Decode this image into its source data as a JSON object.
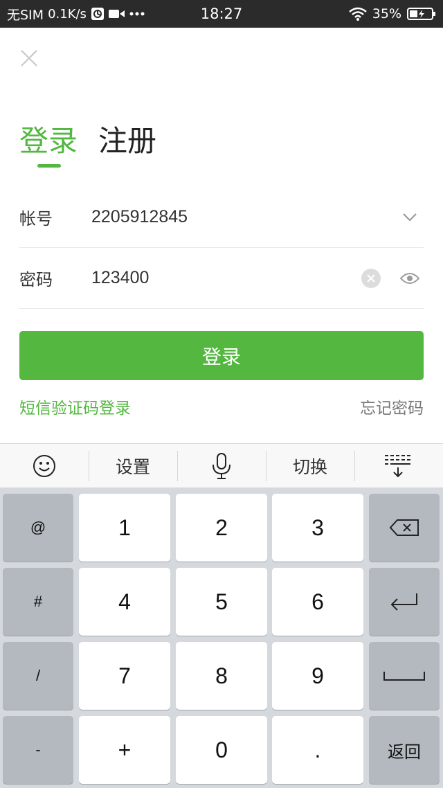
{
  "status_bar": {
    "carrier": "无SIM",
    "speed": "0.1K/s",
    "time": "18:27",
    "battery": "35%",
    "icons": [
      "vpn-icon",
      "video-icon",
      "more-dots-icon",
      "wifi-icon",
      "battery-charging-icon"
    ]
  },
  "header": {
    "close_icon": "close-icon",
    "tabs": [
      {
        "label": "登录",
        "active": true
      },
      {
        "label": "注册",
        "active": false
      }
    ]
  },
  "form": {
    "account": {
      "label": "帐号",
      "value": "2205912845",
      "icon": "chevron-down-icon"
    },
    "password": {
      "label": "密码",
      "value": "123400",
      "icons": [
        "clear-icon",
        "eye-icon"
      ]
    }
  },
  "actions": {
    "login_label": "登录",
    "sms_login_label": "短信验证码登录",
    "forgot_password_label": "忘记密码"
  },
  "keyboard": {
    "toolbar": {
      "emoji_icon": "emoji-icon",
      "settings_label": "设置",
      "mic_icon": "microphone-icon",
      "switch_label": "切换",
      "hide_icon": "keyboard-hide-icon"
    },
    "left_keys": [
      "@",
      "#",
      "/",
      "-"
    ],
    "num_rows": [
      [
        "1",
        "2",
        "3"
      ],
      [
        "4",
        "5",
        "6"
      ],
      [
        "7",
        "8",
        "9"
      ],
      [
        "+",
        "0",
        "."
      ]
    ],
    "right_keys": {
      "backspace_icon": "backspace-icon",
      "enter_icon": "enter-icon",
      "space_icon": "space-icon",
      "return_label": "返回"
    }
  },
  "colors": {
    "accent": "#53b740",
    "status_bar_bg": "#2b2b2b",
    "keyboard_bg": "#d5d8dc",
    "side_key_bg": "#b4b9bf"
  }
}
